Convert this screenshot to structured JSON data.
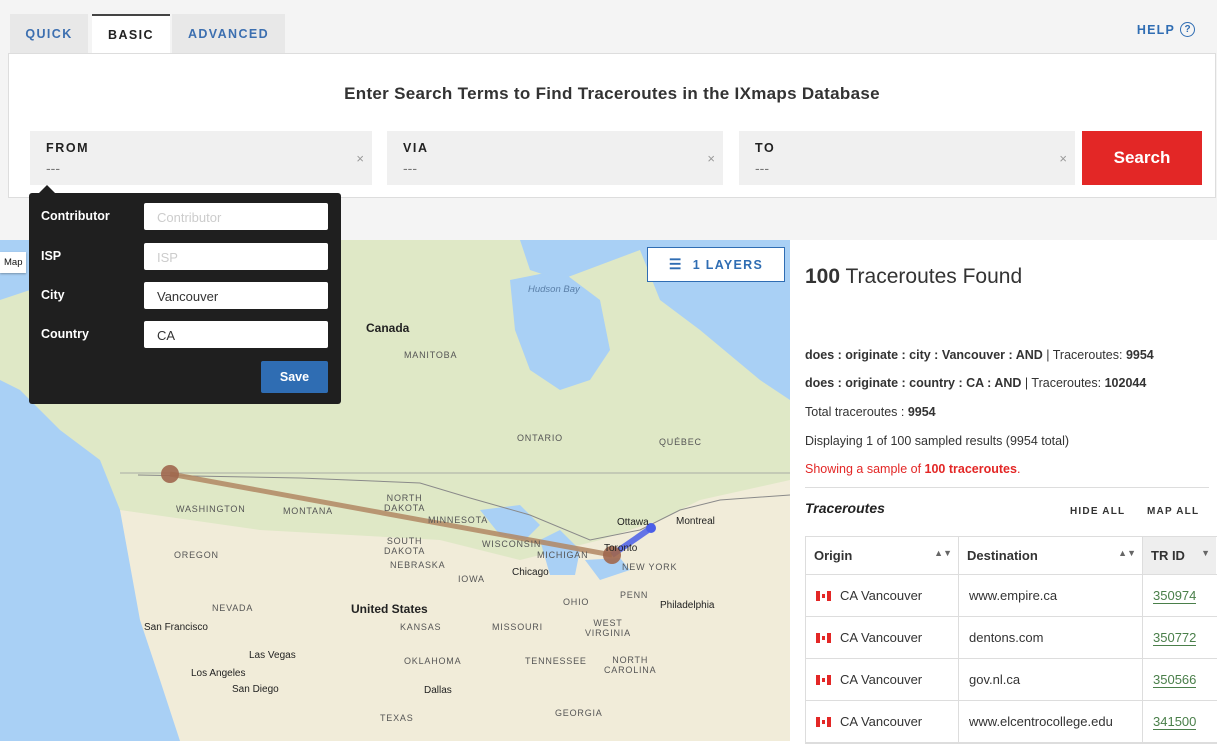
{
  "tabs": [
    {
      "label": "QUICK"
    },
    {
      "label": "BASIC"
    },
    {
      "label": "ADVANCED"
    }
  ],
  "help": {
    "label": "HELP",
    "icon": "?"
  },
  "search": {
    "headline": "Enter Search Terms to Find Traceroutes in the IXmaps Database",
    "from": {
      "label": "FROM",
      "value": "---"
    },
    "via": {
      "label": "VIA",
      "value": "---"
    },
    "to": {
      "label": "TO",
      "value": "---"
    },
    "clear_glyph": "×",
    "button": "Search"
  },
  "popup": {
    "fields": [
      {
        "label": "Contributor",
        "value": "",
        "placeholder": "Contributor"
      },
      {
        "label": "ISP",
        "value": "",
        "placeholder": "ISP"
      },
      {
        "label": "City",
        "value": "Vancouver",
        "placeholder": ""
      },
      {
        "label": "Country",
        "value": "CA",
        "placeholder": ""
      }
    ],
    "save": "Save"
  },
  "map": {
    "type_label": "Map",
    "layers_label": "1 LAYERS",
    "labels": {
      "canada": "Canada",
      "hudson_bay": "Hudson Bay",
      "manitoba": "MANITOBA",
      "ontario": "ONTARIO",
      "quebec": "QUÉBEC",
      "washington": "WASHINGTON",
      "montana": "MONTANA",
      "north_dakota": "NORTH\nDAKOTA",
      "south_dakota": "SOUTH\nDAKOTA",
      "minnesota": "MINNESOTA",
      "wisconsin": "WISCONSIN",
      "michigan": "MICHIGAN",
      "oregon": "OREGON",
      "nebraska": "NEBRASKA",
      "iowa": "IOWA",
      "nevada": "NEVADA",
      "united_states": "United States",
      "kansas": "KANSAS",
      "missouri": "MISSOURI",
      "oklahoma": "OKLAHOMA",
      "tennessee": "TENNESSEE",
      "new_york": "NEW YORK",
      "penn": "PENN",
      "ohio": "OHIO",
      "west_virginia": "WEST\nVIRGINIA",
      "north_carolina": "NORTH\nCAROLINA",
      "chicago": "Chicago",
      "ottawa": "Ottawa",
      "montreal": "Montreal",
      "toronto": "Toronto",
      "philadelphia": "Philadelphia",
      "san_francisco": "San Francisco",
      "las_vegas": "Las Vegas",
      "los_angeles": "Los Angeles",
      "san_diego": "San Diego",
      "dallas": "Dallas",
      "texas": "TEXAS",
      "georgia": "GEORGIA"
    },
    "route_color": "#b28763",
    "route2_color": "#4a5ee8"
  },
  "results": {
    "count": "100",
    "found_text": " Traceroutes Found",
    "query1": {
      "bold": "does : originate : city : Vancouver : AND",
      "sep": " | Traceroutes: ",
      "num": "9954"
    },
    "query2": {
      "bold": "does : originate : country : CA : AND",
      "sep": " | Traceroutes: ",
      "num": "102044"
    },
    "total": {
      "prefix": "Total traceroutes : ",
      "num": "9954"
    },
    "displaying": "Displaying 1 of 100 sampled results (9954 total)",
    "sample": {
      "prefix": "Showing a sample of ",
      "bold": "100 traceroutes",
      "suffix": "."
    },
    "section_title": "Traceroutes",
    "hide_all": "HIDE ALL",
    "map_all": "MAP ALL",
    "columns": [
      "Origin",
      "Destination",
      "TR ID"
    ],
    "rows": [
      {
        "origin": "CA Vancouver",
        "destination": "www.empire.ca",
        "trid": "350974"
      },
      {
        "origin": "CA Vancouver",
        "destination": "dentons.com",
        "trid": "350772"
      },
      {
        "origin": "CA Vancouver",
        "destination": "gov.nl.ca",
        "trid": "350566"
      },
      {
        "origin": "CA Vancouver",
        "destination": "www.elcentrocollege.edu",
        "trid": "341500"
      }
    ]
  }
}
